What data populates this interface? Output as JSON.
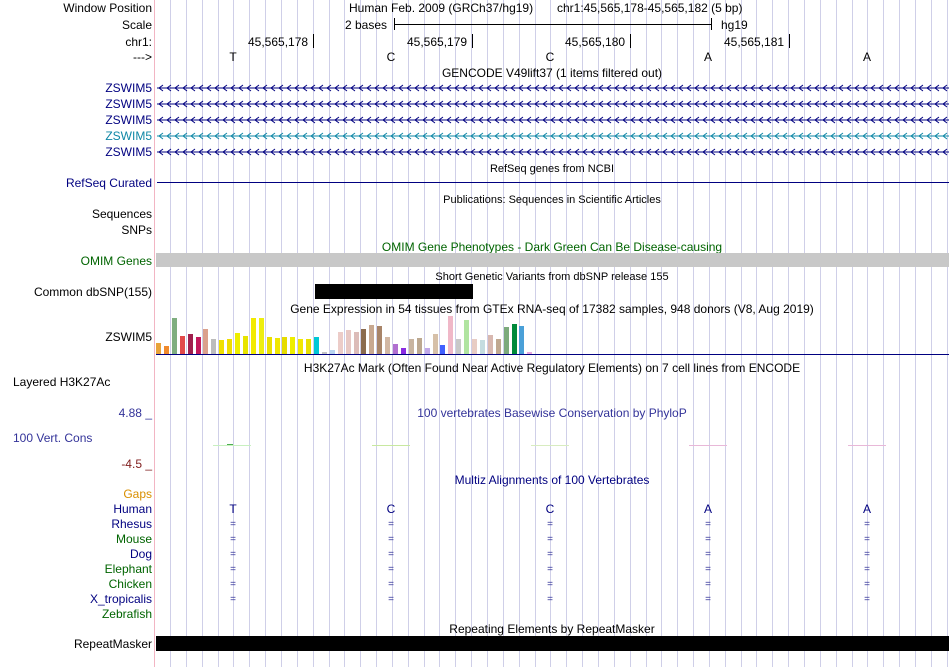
{
  "colors": {
    "navy": "#000080",
    "gencode_teal": "#0e87a6",
    "omim_green": "#006400",
    "gaps_orange": "#d98f00",
    "cons_blue": "#333399",
    "neg_red": "#7f1d1d",
    "border_pink": "#f2b5c3",
    "gridline": "#cfcfe8",
    "omim_bar": "#c8c8c8"
  },
  "ruler": {
    "window_label": "Window Position",
    "scale_label": "Scale",
    "chrom_label": "chr1:",
    "strand_label": "--->",
    "assembly": "Human Feb. 2009 (GRCh37/hg19)",
    "position": "chr1:45,565,178-45,565,182 (5 bp)",
    "scale_text": "2 bases",
    "db_label": "hg19",
    "coords": [
      "45,565,178",
      "45,565,179",
      "45,565,180",
      "45,565,181"
    ],
    "bases": [
      "T",
      "C",
      "C",
      "A",
      "A"
    ]
  },
  "gencode": {
    "title": "GENCODE V49lift37 (1 items filtered out)",
    "transcripts": [
      {
        "label": "ZSWIM5",
        "color": "#000080"
      },
      {
        "label": "ZSWIM5",
        "color": "#000080"
      },
      {
        "label": "ZSWIM5",
        "color": "#000080"
      },
      {
        "label": "ZSWIM5",
        "color": "#0e87a6"
      },
      {
        "label": "ZSWIM5",
        "color": "#000080"
      }
    ]
  },
  "refseq": {
    "title": "RefSeq genes from NCBI",
    "label": "RefSeq Curated"
  },
  "pubs": {
    "title": "Publications: Sequences in Scientific Articles",
    "label": "Sequences"
  },
  "snps": {
    "label": "SNPs"
  },
  "omim": {
    "title": "OMIM Gene Phenotypes - Dark Green Can Be Disease-causing",
    "label": "OMIM Genes"
  },
  "dbsnp": {
    "title": "Short Genetic Variants from dbSNP release 155",
    "label": "Common dbSNP(155)"
  },
  "gtex": {
    "title": "Gene Expression in 54 tissues from GTEx RNA-seq of 17382 samples, 948 donors (V8, Aug 2019)",
    "label": "ZSWIM5",
    "bars": [
      {
        "v": 0.3,
        "c": "#e8a23a"
      },
      {
        "v": 0.22,
        "c": "#f08a2c"
      },
      {
        "v": 0.95,
        "c": "#7fae7f"
      },
      {
        "v": 0.48,
        "c": "#e24a4a"
      },
      {
        "v": 0.52,
        "c": "#a01f4d"
      },
      {
        "v": 0.46,
        "c": "#c2185b"
      },
      {
        "v": 0.66,
        "c": "#dba08c"
      },
      {
        "v": 0.4,
        "c": "#bcbcbc"
      },
      {
        "v": 0.36,
        "c": "#f0e000"
      },
      {
        "v": 0.4,
        "c": "#eedd00"
      },
      {
        "v": 0.55,
        "c": "#eeee00"
      },
      {
        "v": 0.48,
        "c": "#e8e400"
      },
      {
        "v": 0.96,
        "c": "#f2ea00"
      },
      {
        "v": 0.96,
        "c": "#eeee10"
      },
      {
        "v": 0.46,
        "c": "#eae000"
      },
      {
        "v": 0.42,
        "c": "#f0e600"
      },
      {
        "v": 0.44,
        "c": "#e6dc00"
      },
      {
        "v": 0.46,
        "c": "#eeee00"
      },
      {
        "v": 0.4,
        "c": "#f2e800"
      },
      {
        "v": 0.4,
        "c": "#e8e000"
      },
      {
        "v": 0.44,
        "c": "#00c8d6"
      },
      {
        "v": 0.06,
        "c": "#c4c4c4"
      },
      {
        "v": 0.1,
        "c": "#b8d4f0"
      },
      {
        "v": 0.58,
        "c": "#ecccc8"
      },
      {
        "v": 0.64,
        "c": "#e8c8c4"
      },
      {
        "v": 0.58,
        "c": "#dcbcb8"
      },
      {
        "v": 0.66,
        "c": "#8b6b4e"
      },
      {
        "v": 0.76,
        "c": "#c8a890"
      },
      {
        "v": 0.74,
        "c": "#a88468"
      },
      {
        "v": 0.46,
        "c": "#d2b8a4"
      },
      {
        "v": 0.26,
        "c": "#b06fd0"
      },
      {
        "v": 0.16,
        "c": "#8a2be2"
      },
      {
        "v": 0.4,
        "c": "#c8b4a0"
      },
      {
        "v": 0.42,
        "c": "#bca890"
      },
      {
        "v": 0.16,
        "c": "#c0a8e8"
      },
      {
        "v": 0.52,
        "c": "#d6c0a8"
      },
      {
        "v": 0.24,
        "c": "#4060ff"
      },
      {
        "v": 1.0,
        "c": "#f0b8c8"
      },
      {
        "v": 0.4,
        "c": "#c8c8c8"
      },
      {
        "v": 0.9,
        "c": "#b0e4a0"
      },
      {
        "v": 0.4,
        "c": "#e8ccc4"
      },
      {
        "v": 0.36,
        "c": "#c4dce0"
      },
      {
        "v": 0.5,
        "c": "#d8b8b0"
      },
      {
        "v": 0.4,
        "c": "#c0a890"
      },
      {
        "v": 0.72,
        "c": "#7caa7c"
      },
      {
        "v": 0.8,
        "c": "#008a3a"
      },
      {
        "v": 0.74,
        "c": "#4aa0d8"
      },
      {
        "v": 0.06,
        "c": "#e8a8e0"
      }
    ]
  },
  "h3k27ac": {
    "title": "H3K27Ac Mark (Often Found Near Active Regulatory Elements) on 7 cell lines from ENCODE",
    "label": "Layered H3K27Ac"
  },
  "phylop": {
    "title": "100 vertebrates Basewise Conservation by PhyloP",
    "label": "100 Vert. Cons",
    "max": "4.88 _",
    "min": "-4.5 _"
  },
  "multiz": {
    "title": "Multiz Alignments of 100 Vertebrates",
    "gaps_label": "Gaps",
    "species": [
      {
        "name": "Human",
        "color": "#000080",
        "row": [
          "T",
          "C",
          "C",
          "A",
          "A"
        ]
      },
      {
        "name": "Rhesus",
        "color": "#000080",
        "row": [
          "=",
          "=",
          "=",
          "=",
          "="
        ]
      },
      {
        "name": "Mouse",
        "color": "#006400",
        "row": [
          "=",
          "=",
          "=",
          "=",
          "="
        ]
      },
      {
        "name": "Dog",
        "color": "#000080",
        "row": [
          "=",
          "=",
          "=",
          "=",
          "="
        ]
      },
      {
        "name": "Elephant",
        "color": "#006400",
        "row": [
          "=",
          "=",
          "=",
          "=",
          "="
        ]
      },
      {
        "name": "Chicken",
        "color": "#006400",
        "row": [
          "=",
          "=",
          "=",
          "=",
          "="
        ]
      },
      {
        "name": "X_tropicalis",
        "color": "#000080",
        "row": [
          "=",
          "=",
          "=",
          "=",
          "="
        ]
      },
      {
        "name": "Zebrafish",
        "color": "#006400",
        "row": [
          "",
          "",
          "",
          "",
          ""
        ]
      }
    ]
  },
  "rmsk": {
    "title": "Repeating Elements by RepeatMasker",
    "label": "RepeatMasker"
  }
}
